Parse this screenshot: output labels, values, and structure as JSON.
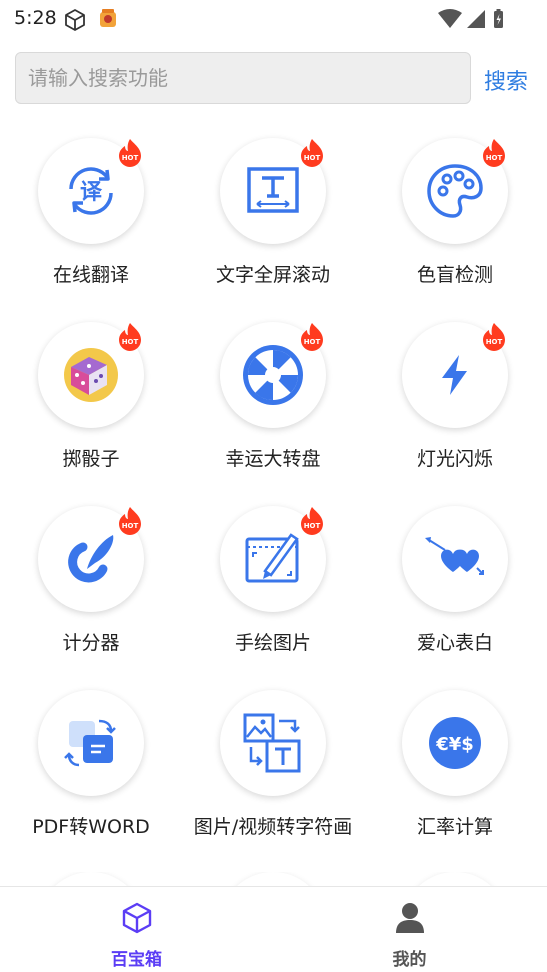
{
  "status_bar": {
    "time": "5:28"
  },
  "search": {
    "placeholder": "请输入搜索功能",
    "button_label": "搜索"
  },
  "hot_badge": "HOT",
  "tools": [
    {
      "label": "在线翻译",
      "icon": "translate-icon",
      "hot": true
    },
    {
      "label": "文字全屏滚动",
      "icon": "text-fullscreen-icon",
      "hot": true
    },
    {
      "label": "色盲检测",
      "icon": "palette-icon",
      "hot": true
    },
    {
      "label": "掷骰子",
      "icon": "dice-icon",
      "hot": true
    },
    {
      "label": "幸运大转盘",
      "icon": "wheel-icon",
      "hot": true
    },
    {
      "label": "灯光闪烁",
      "icon": "lightning-icon",
      "hot": true
    },
    {
      "label": "计分器",
      "icon": "score-icon",
      "hot": true
    },
    {
      "label": "手绘图片",
      "icon": "drawing-icon",
      "hot": true
    },
    {
      "label": "爱心表白",
      "icon": "hearts-icon",
      "hot": false
    },
    {
      "label": "PDF转WORD",
      "icon": "pdf-convert-icon",
      "hot": false
    },
    {
      "label": "图片/视频转字符画",
      "icon": "image-convert-icon",
      "hot": false
    },
    {
      "label": "汇率计算",
      "icon": "currency-icon",
      "hot": false
    }
  ],
  "tabs": [
    {
      "label": "百宝箱",
      "icon": "cube-icon",
      "active": true
    },
    {
      "label": "我的",
      "icon": "user-icon",
      "active": false
    }
  ],
  "colors": {
    "accent": "#2f7de1",
    "icon_blue": "#3a76ea",
    "active_tab": "#5b3df5",
    "inactive_tab": "#555555",
    "hot": "#ff3b1f"
  }
}
